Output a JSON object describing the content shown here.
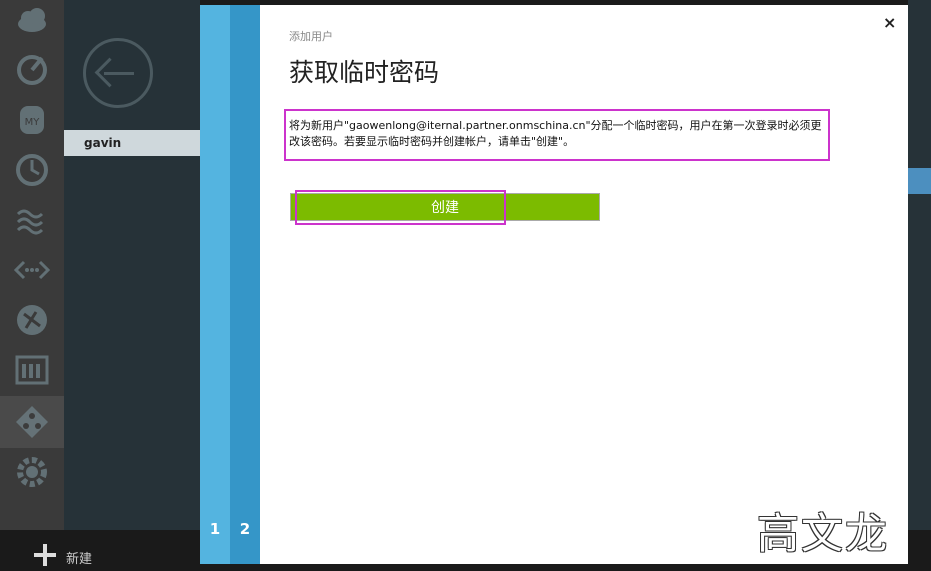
{
  "portal": {
    "row_name": "gavin",
    "new_label": "新建",
    "nav_icons": [
      "cloud-icon",
      "gauge-icon",
      "mysql-icon",
      "clock-icon",
      "waves-icon",
      "code-icon",
      "network-icon",
      "grid-icon",
      "directory-icon",
      "gear-icon"
    ]
  },
  "wizard": {
    "subtitle": "添加用户",
    "title": "获取临时密码",
    "description": "将为新用户\"gaowenlong@iternal.partner.onmschina.cn\"分配一个临时密码，用户在第一次登录时必须更改该密码。若要显示临时密码并创建帐户，请单击\"创建\"。",
    "create_label": "创建",
    "close_label": "×",
    "steps": [
      "1",
      "2"
    ]
  },
  "watermark": "高文龙",
  "colors": {
    "accent_green": "#7cbb00",
    "step_blue_light": "#54b4e0",
    "step_blue_dark": "#3596c8",
    "highlight": "#cc33cc"
  }
}
